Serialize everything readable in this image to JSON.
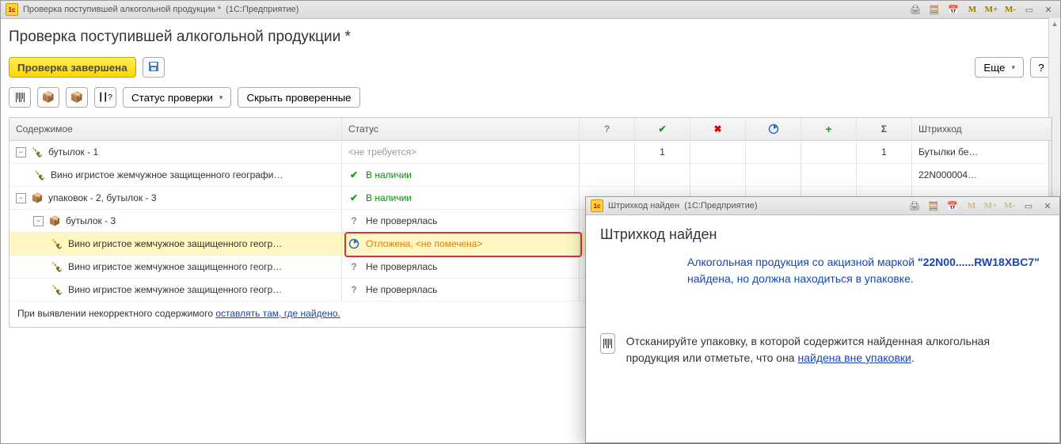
{
  "window": {
    "title_doc": "Проверка поступившей алкогольной продукции *",
    "title_app": "(1С:Предприятие)"
  },
  "page": {
    "heading": "Проверка поступившей алкогольной продукции *"
  },
  "buttons": {
    "finish_check": "Проверка завершена",
    "more": "Еще",
    "help": "?",
    "status_check": "Статус проверки",
    "hide_checked": "Скрыть проверенные"
  },
  "columns": {
    "content": "Содержимое",
    "status": "Статус",
    "question": "?",
    "check": "✔",
    "x": "✖",
    "clock": "◔",
    "plus": "+",
    "sum": "Σ",
    "barcode": "Штрихкод"
  },
  "rows": [
    {
      "indent": 0,
      "toggle": "−",
      "icon": "bottles",
      "label": "бутылок -  1",
      "status_text": "<не требуется>",
      "status_kind": "gray",
      "chk": "1",
      "sum": "1",
      "bar": "Бутылки бе…"
    },
    {
      "indent": 1,
      "icon": "bottle",
      "label": "Вино игристое жемчужное защищенного географи…",
      "status_text": "В наличии",
      "status_kind": "green",
      "bar": "22N000004…"
    },
    {
      "indent": 0,
      "toggle": "−",
      "icon": "box",
      "label": "упаковок -  2, бутылок -  3",
      "status_text": "В наличии",
      "status_kind": "green"
    },
    {
      "indent": 1,
      "toggle": "−",
      "icon": "box",
      "label": "бутылок -  3",
      "status_text": "Не проверялась",
      "status_kind": "q"
    },
    {
      "indent": 2,
      "icon": "bottle",
      "label": "Вино игристое жемчужное защищенного геогр…",
      "status_text": "Отложена, <не помечена>",
      "status_kind": "orange",
      "selected": true
    },
    {
      "indent": 2,
      "icon": "bottle",
      "label": "Вино игристое жемчужное защищенного геогр…",
      "status_text": "Не проверялась",
      "status_kind": "q"
    },
    {
      "indent": 2,
      "icon": "bottle",
      "label": "Вино игристое жемчужное защищенного геогр…",
      "status_text": "Не проверялась",
      "status_kind": "q"
    }
  ],
  "footnote": {
    "prefix": "При выявлении некорректного содержимого ",
    "link": "оставлять там, где найдено."
  },
  "modal": {
    "title_doc": "Штрихкод найден",
    "title_app": "(1С:Предприятие)",
    "heading": "Штрихкод найден",
    "msg_1": "Алкогольная продукция со акцизной маркой ",
    "msg_code": "\"22N00......RW18XBC7\"",
    "msg_2": " найдена, но должна находиться в упаковке.",
    "hint_1": "Отсканируйте упаковку, в которой содержится найденная алкогольная продукция или отметьте, что она ",
    "hint_link": "найдена вне упаковки",
    "hint_dot": "."
  }
}
